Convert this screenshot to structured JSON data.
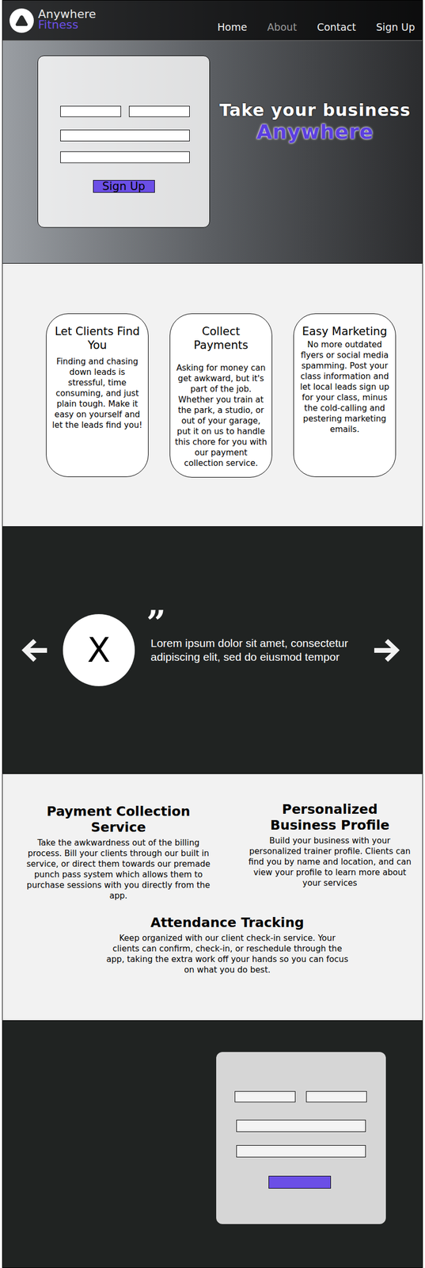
{
  "brand": {
    "name": "Anywhere",
    "sub": "Fitness"
  },
  "nav": [
    {
      "label": "Home",
      "selected": false
    },
    {
      "label": "About",
      "selected": true
    },
    {
      "label": "Contact",
      "selected": false
    },
    {
      "label": "Sign Up",
      "selected": false
    }
  ],
  "hero": {
    "headline": "Take your business",
    "highlight": "Anywhere",
    "button": "Sign Up"
  },
  "features": [
    {
      "title": "Let Clients Find You",
      "body": "Finding and chasing down leads is stressful, time consuming, and just plain tough. Make it easy on yourself and let the leads find you!"
    },
    {
      "title": "Collect Payments",
      "body": "Asking for money can get awkward, but it's part of the job. Whether you train at the park, a studio, or out of your garage, put it on us to handle this chore for you with our payment collection service."
    },
    {
      "title": "Easy Marketing",
      "body": "No more outdated flyers or social media spamming. Post your class information and let local leads sign up for your class, minus the cold-calling and pestering marketing emails."
    }
  ],
  "testimonial": {
    "avatar": "X",
    "quote_mark": "”",
    "text": "Lorem ipsum dolor sit amet, consectetur adipiscing elit, sed do eiusmod tempor"
  },
  "services": [
    {
      "title": "Payment Collection Service",
      "body": "Take the awkwardness out of the billing process. Bill your clients through our built in service, or direct them towards our premade punch pass system which allows them to purchase sessions with you directly from the app."
    },
    {
      "title": "Personalized Business Profile",
      "body": "Build your business with your personalized trainer profile. Clients can find you by name and location, and can view your profile to learn more about your services"
    },
    {
      "title": "Attendance Tracking",
      "body": "Keep organized with our client check-in service. Your clients can confirm, check-in, or reschedule through the app, taking the extra work off your hands so you can focus on what you do best."
    }
  ]
}
